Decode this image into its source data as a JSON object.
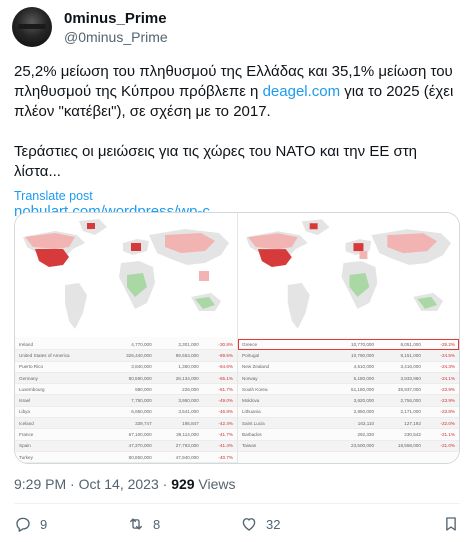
{
  "author": {
    "display_name": "0minus_Prime",
    "handle": "@0minus_Prime"
  },
  "tweet": {
    "line1_pre": "25,2% μείωση του πληθυσμού της Ελλάδας και 35,1% μείωση του πληθυσμού της Κύπρου πρόβλεπε η ",
    "line1_link": "deagel.com",
    "line1_post": " για το 2025 (έχει πλέον \"κατέβει\"), σε σχέση με το 2017.",
    "line2": "Τεράστιες οι μειώσεις για τις χώρες του ΝΑΤΟ και την ΕΕ στη λίστα...",
    "url": "nobulart.com/wordpress/wp-c...",
    "translate_label": "Translate post"
  },
  "media": {
    "left_table": [
      {
        "country": "Ireland",
        "pop2017": "4,770,000",
        "pop2025": "3,301,000",
        "change": "-30.8%"
      },
      {
        "country": "United States of America",
        "pop2017": "326,440,000",
        "pop2025": "99,553,000",
        "change": "-69.5%"
      },
      {
        "country": "Puerto Rico",
        "pop2017": "3,840,000",
        "pop2025": "1,360,000",
        "change": "-64.6%"
      },
      {
        "country": "Germany",
        "pop2017": "80,590,000",
        "pop2025": "28,134,000",
        "change": "-65.1%"
      },
      {
        "country": "Luxembourg",
        "pop2017": "590,000",
        "pop2025": "226,000",
        "change": "-61.7%"
      },
      {
        "country": "Israel",
        "pop2017": "7,750,000",
        "pop2025": "3,950,000",
        "change": "-49.0%"
      },
      {
        "country": "Libya",
        "pop2017": "6,650,000",
        "pop2025": "3,541,000",
        "change": "-46.8%"
      },
      {
        "country": "Iceland",
        "pop2017": "339,747",
        "pop2025": "195,847",
        "change": "-42.4%"
      },
      {
        "country": "France",
        "pop2017": "67,100,000",
        "pop2025": "39,114,000",
        "change": "-41.7%"
      },
      {
        "country": "Spain",
        "pop2017": "47,370,000",
        "pop2025": "27,763,000",
        "change": "-41.4%"
      },
      {
        "country": "Turkey",
        "pop2017": "80,850,000",
        "pop2025": "47,940,000",
        "change": "-40.7%"
      }
    ],
    "right_table": [
      {
        "country": "Greece",
        "pop2017": "10,770,000",
        "pop2025": "8,051,000",
        "change": "-25.2%"
      },
      {
        "country": "Portugal",
        "pop2017": "10,790,000",
        "pop2025": "8,151,000",
        "change": "-24.5%"
      },
      {
        "country": "New Zealand",
        "pop2017": "4,510,000",
        "pop2025": "3,416,000",
        "change": "-24.3%"
      },
      {
        "country": "Norway",
        "pop2017": "5,180,000",
        "pop2025": "3,933,960",
        "change": "-24.1%"
      },
      {
        "country": "South Korea",
        "pop2017": "51,180,000",
        "pop2025": "38,937,000",
        "change": "-23.9%"
      },
      {
        "country": "Moldova",
        "pop2017": "3,620,000",
        "pop2025": "2,756,000",
        "change": "-23.9%"
      },
      {
        "country": "Lithuania",
        "pop2017": "2,850,000",
        "pop2025": "2,171,000",
        "change": "-23.8%"
      },
      {
        "country": "Saint Lucia",
        "pop2017": "163,110",
        "pop2025": "127,192",
        "change": "-22.0%"
      },
      {
        "country": "Barbados",
        "pop2017": "292,330",
        "pop2025": "230,542",
        "change": "-21.1%"
      },
      {
        "country": "Taiwan",
        "pop2017": "23,500,000",
        "pop2025": "18,558,000",
        "change": "-21.0%"
      }
    ]
  },
  "meta": {
    "time": "9:29 PM · Oct 14, 2023 · ",
    "views_count": "929",
    "views_label": " Views"
  },
  "actions": {
    "replies": "9",
    "reposts": "8",
    "likes": "32"
  },
  "colors": {
    "link": "#1d9bf0",
    "secondary_text": "#536471",
    "map_decline_strong": "#d63a3a",
    "map_decline_light": "#f2b3b3",
    "map_growth": "#a9d8a5"
  }
}
